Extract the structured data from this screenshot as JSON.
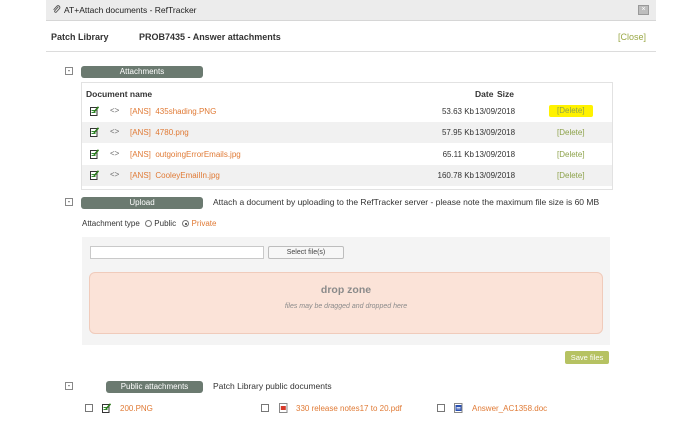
{
  "window": {
    "title": "AT+Attach documents - RefTracker",
    "close_glyph": "×"
  },
  "header": {
    "module": "Patch Library",
    "subtitle": "PROB7435 - Answer attachments",
    "close_label": "[Close]"
  },
  "attachments": {
    "toggle": "-",
    "section_label": "Attachments",
    "columns": {
      "name": "Document name",
      "size": "Size",
      "date": "Date"
    },
    "rows": [
      {
        "prefix": "[ANS]",
        "name": "435shading.PNG",
        "size": "53.63 Kb",
        "date": "13/09/2018",
        "action": "[Delete]",
        "highlighted": true
      },
      {
        "prefix": "[ANS]",
        "name": "4780.png",
        "size": "57.95 Kb",
        "date": "13/09/2018",
        "action": "[Delete]",
        "highlighted": false
      },
      {
        "prefix": "[ANS]",
        "name": "outgoingErrorEmails.jpg",
        "size": "65.11 Kb",
        "date": "13/09/2018",
        "action": "[Delete]",
        "highlighted": false
      },
      {
        "prefix": "[ANS]",
        "name": "CooleyEmailIn.jpg",
        "size": "160.78 Kb",
        "date": "13/09/2018",
        "action": "[Delete]",
        "highlighted": false
      }
    ],
    "link_glyph": "<>"
  },
  "upload": {
    "toggle": "-",
    "section_label": "Upload",
    "description": "Attach a document by uploading to the RefTracker server - please note the maximum file size is 60 MB",
    "attachment_type_label": "Attachment type",
    "option_public": "Public",
    "option_private": "Private",
    "selected": "Private",
    "file_value": "",
    "select_button": "Select file(s)",
    "drop_title": "drop zone",
    "drop_subtitle": "files may be dragged and dropped here",
    "save_button": "Save files"
  },
  "public": {
    "toggle": "-",
    "section_label": "Public attachments",
    "description": "Patch Library public documents",
    "items": [
      {
        "name": "200.PNG",
        "icon": "image-file-icon"
      },
      {
        "name": "330 release notes17 to 20.pdf",
        "icon": "pdf-file-icon"
      },
      {
        "name": "Answer_AC1358.doc",
        "icon": "word-file-icon"
      }
    ]
  },
  "colors": {
    "link": "#e07a35",
    "action": "#8da24a",
    "pill": "#6b7a70",
    "highlight": "#fff200",
    "drop_zone": "#fbe3d8",
    "save": "#b6c262"
  }
}
